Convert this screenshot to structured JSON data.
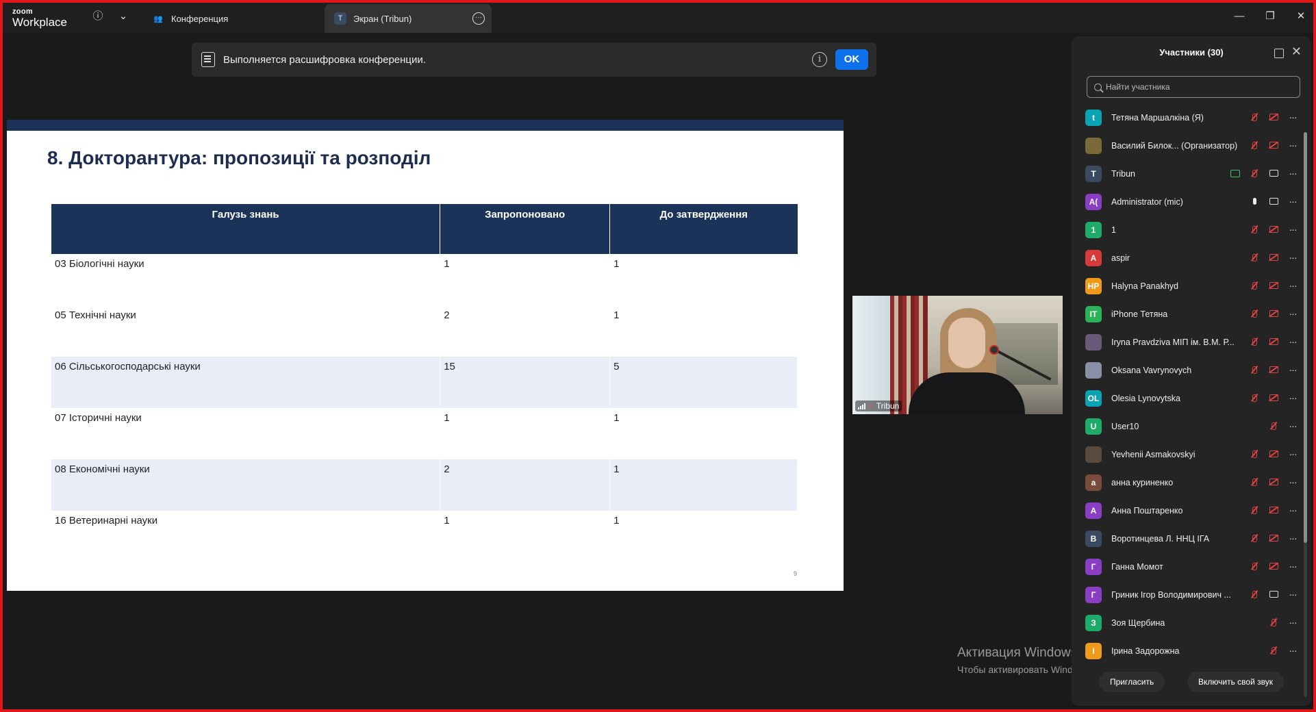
{
  "app": {
    "brand_small": "zoom",
    "brand_large": "Workplace"
  },
  "tabs": [
    {
      "label": "Конференция",
      "icon": "people-icon"
    },
    {
      "label": "Экран (Tribun)",
      "badge": "T",
      "icon": "screen-badge"
    }
  ],
  "banner": {
    "text": "Выполняется расшифровка конференции.",
    "info": "i",
    "ok_label": "OK"
  },
  "slide": {
    "title": "8. Докторантура: пропозиції та розподіл",
    "headers": [
      "Галузь знань",
      "Запропоновано",
      "До затвердження"
    ],
    "rows": [
      [
        "03 Біологічні науки",
        "1",
        "1"
      ],
      [
        "05 Технічні науки",
        "2",
        "1"
      ],
      [
        "06 Сільськогосподарські науки",
        "15",
        "5"
      ],
      [
        "07 Історичні науки",
        "1",
        "1"
      ],
      [
        "08 Економічні науки",
        "2",
        "1"
      ],
      [
        "16 Ветеринарні науки",
        "1",
        "1"
      ]
    ],
    "page_number": "9"
  },
  "video": {
    "name": "Tribun"
  },
  "watermark": {
    "title": "Активация Windows",
    "text": "Чтобы активировать Windows, перейдите в раздел \"Параметры\"."
  },
  "participants": {
    "title": "Участники (30)",
    "search_placeholder": "Найти участника",
    "list": [
      {
        "name": "Тетяна Маршалкіна (Я)",
        "avatar": "t",
        "color": "#0aa3b2",
        "icons": [
          "mic-off",
          "cam-off"
        ]
      },
      {
        "name": "Василий Билок... (Организатор)",
        "avatar": "",
        "color": "#7a6a3a",
        "icons": [
          "mic-off",
          "cam-off"
        ]
      },
      {
        "name": "Tribun",
        "avatar": "T",
        "color": "#3a4a60",
        "icons": [
          "share",
          "mic-off",
          "cam-on"
        ]
      },
      {
        "name": "Administrator (mic)",
        "avatar": "A(",
        "color": "#8a3ec4",
        "icons": [
          "mic-on",
          "cam-on"
        ]
      },
      {
        "name": "1",
        "avatar": "1",
        "color": "#1eab6a",
        "icons": [
          "mic-off",
          "cam-off"
        ]
      },
      {
        "name": "aspir",
        "avatar": "A",
        "color": "#d63a3a",
        "icons": [
          "mic-off",
          "cam-off"
        ]
      },
      {
        "name": "Halyna Panakhyd",
        "avatar": "HP",
        "color": "#ef9a1a",
        "icons": [
          "mic-off",
          "cam-off"
        ]
      },
      {
        "name": "iPhone Тетяна",
        "avatar": "IT",
        "color": "#2bb35a",
        "icons": [
          "mic-off",
          "cam-off"
        ]
      },
      {
        "name": "Iryna Pravdziva МІП ім. В.М. Р...",
        "avatar": "",
        "color": "#6a5a7a",
        "icons": [
          "mic-off",
          "cam-off"
        ]
      },
      {
        "name": "Oksana Vavrynovych",
        "avatar": "",
        "color": "#8a8fa8",
        "icons": [
          "mic-off",
          "cam-off"
        ]
      },
      {
        "name": "Olesia Lynovytska",
        "avatar": "OL",
        "color": "#0aa3b2",
        "icons": [
          "mic-off",
          "cam-off"
        ]
      },
      {
        "name": "User10",
        "avatar": "U",
        "color": "#1eab6a",
        "icons": [
          "mic-off"
        ]
      },
      {
        "name": "Yevhenii Asmakovskyi",
        "avatar": "",
        "color": "#5a4a40",
        "icons": [
          "mic-off",
          "cam-off"
        ]
      },
      {
        "name": "анна куриненко",
        "avatar": "a",
        "color": "#7a4a3a",
        "icons": [
          "mic-off",
          "cam-off"
        ]
      },
      {
        "name": "Анна Поштаренко",
        "avatar": "А",
        "color": "#8a3ec4",
        "icons": [
          "mic-off",
          "cam-off"
        ]
      },
      {
        "name": "Воротинцева Л. ННЦ ІГА",
        "avatar": "В",
        "color": "#3a4a60",
        "icons": [
          "mic-off",
          "cam-off"
        ]
      },
      {
        "name": "Ганна Момот",
        "avatar": "Г",
        "color": "#8a3ec4",
        "icons": [
          "mic-off",
          "cam-off"
        ]
      },
      {
        "name": "Гриник Ігор Володимирович ...",
        "avatar": "Г",
        "color": "#8a3ec4",
        "icons": [
          "mic-off",
          "cam-on"
        ]
      },
      {
        "name": "Зоя Щербина",
        "avatar": "З",
        "color": "#1eab6a",
        "icons": [
          "mic-off"
        ]
      },
      {
        "name": "Ірина Задорожна",
        "avatar": "І",
        "color": "#ef9a1a",
        "icons": [
          "mic-off"
        ]
      }
    ],
    "invite_label": "Пригласить",
    "unmute_label": "Включить свой звук"
  }
}
